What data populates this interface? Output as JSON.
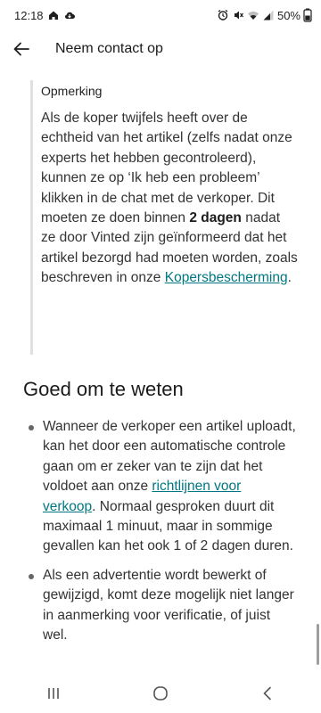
{
  "status_bar": {
    "time": "12:18",
    "battery": "50%",
    "icons": [
      "home-icon",
      "cloud-download-icon",
      "alarm-clock-icon",
      "mute-icon",
      "wifi-icon",
      "signal-icon",
      "battery-icon"
    ]
  },
  "app_bar": {
    "back_icon": "arrow-left-icon",
    "title": "Neem contact op"
  },
  "note": {
    "title": "Opmerking",
    "body_part1": "Als de koper twijfels heeft over de echtheid van het artikel (zelfs nadat onze experts het hebben gecontroleerd), kunnen ze op ‘Ik heb een probleem’ klikken in de chat met de verkoper. Dit moeten ze doen binnen ",
    "body_bold": "2 dagen",
    "body_part2": " nadat ze door Vinted zijn geïnformeerd dat het artikel bezorgd had moeten worden, zoals beschreven in onze ",
    "body_link": "Kopersbescherming",
    "body_end": "."
  },
  "section": {
    "title": "Goed om te weten",
    "bullet1_part1": "Wanneer de verkoper een artikel uploadt, kan het door een automatische controle gaan om er zeker van te zijn dat het voldoet aan onze ",
    "bullet1_link": "richtlijnen voor verkoop",
    "bullet1_part2": ". Normaal gesproken duurt dit maximaal 1 minuut, maar in sommige gevallen kan het ook 1 of 2 dagen duren.",
    "bullet2": "Als een advertentie wordt bewerkt of gewijzigd, komt deze mogelijk niet langer in aanmerking voor verificatie, of juist wel."
  },
  "nav_bar": {
    "icons": [
      "recent-apps-icon",
      "home-circle-icon",
      "back-chevron-icon"
    ]
  },
  "colors": {
    "link": "#007782",
    "text": "#333333",
    "background": "#ffffff"
  }
}
